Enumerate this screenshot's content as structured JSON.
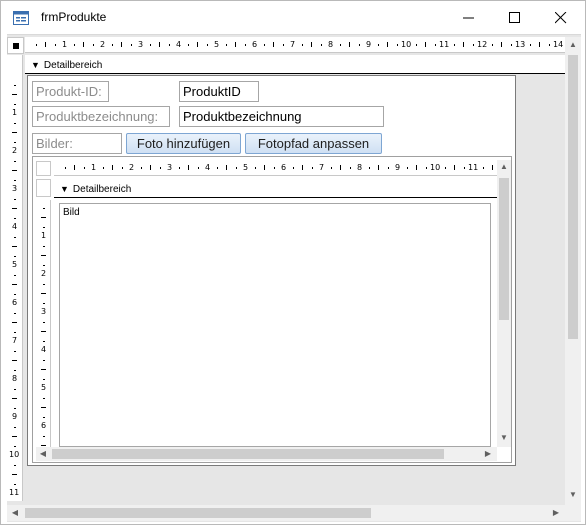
{
  "window": {
    "title": "frmProdukte",
    "icon": "form-icon"
  },
  "section": {
    "detail_label": "Detailbereich"
  },
  "ruler": {
    "h_labels": [
      "1",
      "2",
      "3",
      "4",
      "5",
      "6",
      "7",
      "8",
      "9",
      "10",
      "11",
      "12",
      "13",
      "14"
    ],
    "v_labels": [
      "1",
      "2",
      "3",
      "4",
      "5",
      "6",
      "7",
      "8",
      "9",
      "10",
      "11"
    ]
  },
  "form": {
    "produkt_id_label": "Produkt-ID:",
    "produkt_id_field": "ProduktID",
    "bezeichnung_label": "Produktbezeichnung:",
    "bezeichnung_field": "Produktbezeichnung",
    "bilder_label": "Bilder:",
    "btn_foto_hinzufuegen": "Foto hinzufügen",
    "btn_fotopfad_anpassen": "Fotopfad anpassen"
  },
  "subform": {
    "section_label": "Detailbereich",
    "h_labels": [
      "1",
      "2",
      "3",
      "4",
      "5",
      "6",
      "7",
      "8",
      "9",
      "10",
      "11"
    ],
    "v_labels": [
      "1",
      "2",
      "3",
      "4",
      "5",
      "6"
    ],
    "image_label": "Bild"
  }
}
